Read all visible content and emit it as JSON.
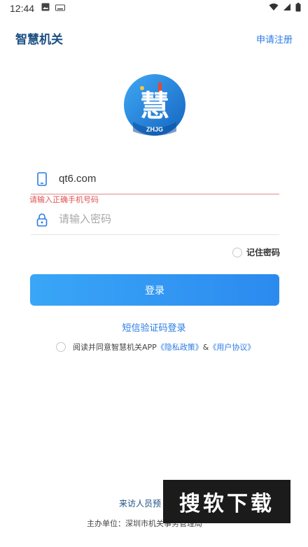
{
  "status_bar": {
    "time": "12:44"
  },
  "header": {
    "title": "智慧机关",
    "register": "申请注册"
  },
  "logo": {
    "character": "慧",
    "caption": "ZHJG"
  },
  "phone": {
    "value": "qt6.com",
    "error": "请输入正确手机号码"
  },
  "password": {
    "placeholder": "请输入密码"
  },
  "remember": {
    "label": "记住密码"
  },
  "login": {
    "label": "登录"
  },
  "sms_login": {
    "label": "短信验证码登录"
  },
  "agreement": {
    "prefix": "阅读并同意智慧机关APP",
    "privacy": "《隐私政策》",
    "and": "&",
    "terms": "《用户协议》"
  },
  "footer": {
    "visitor": "来访人员预",
    "sponsor": "主办单位：深圳市机关事务管理局"
  },
  "watermark": {
    "text": "搜软下载"
  },
  "colors": {
    "accent": "#2a7be4",
    "title": "#1c4f82",
    "error": "#e05252",
    "button": "#2c8aef"
  }
}
